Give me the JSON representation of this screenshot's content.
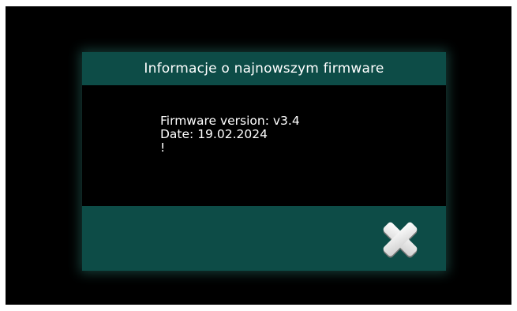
{
  "dialog": {
    "title": "Informacje o najnowszym firmware",
    "lines": [
      "Firmware version: v3.4",
      "Date: 19.02.2024",
      "!"
    ],
    "close_icon": "close-x-icon"
  },
  "colors": {
    "background": "#000000",
    "panel": "#0d4c47",
    "text": "#ffffff",
    "icon": "#e8e8e8"
  }
}
